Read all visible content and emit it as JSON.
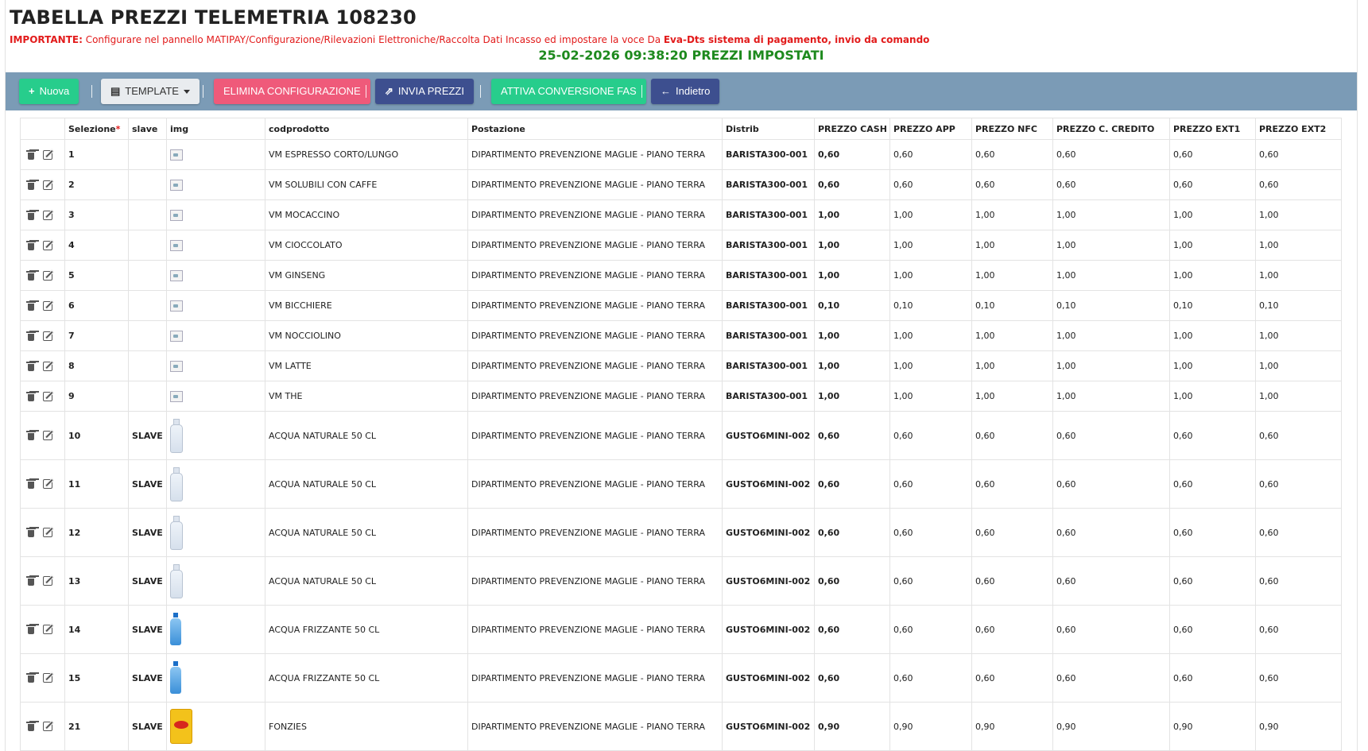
{
  "page": {
    "title": "TABELLA PREZZI TELEMETRIA 108230",
    "notice_label": "IMPORTANTE:",
    "notice_text": " Configurare nel pannello MATIPAY/Configurazione/Rilevazioni Elettroniche/Raccolta Dati Incasso ed impostare la voce Da ",
    "notice_bold": "Eva-Dts sistema di pagamento, invio da comando",
    "status_line": "25-02-2026 09:38:20 PREZZI IMPOSTATI"
  },
  "toolbar": {
    "new_label": "Nuova",
    "template_label": "TEMPLATE",
    "delete_config_label": "ELIMINA CONFIGURAZIONE",
    "send_prices_label": "INVIA PREZZI",
    "enable_conversion_label": "ATTIVA CONVERSIONE FAS",
    "back_label": "Indietro"
  },
  "colors": {
    "toolbar_bg": "#7b9bb6",
    "green_button": "#27cd8c",
    "red_button": "#ef5a7a",
    "navy_button": "#3d4f8f",
    "status_green": "#1e8a1e",
    "notice_red": "#e21b1b"
  },
  "table": {
    "headers": {
      "selezione": "Selezione",
      "required_mark": "*",
      "slave": "slave",
      "img": "img",
      "codprodotto": "codprodotto",
      "postazione": "Postazione",
      "distrib": "Distrib",
      "prezzo_cash": "PREZZO CASH",
      "prezzo_app": "PREZZO APP",
      "prezzo_nfc": "PREZZO NFC",
      "prezzo_cc": "PREZZO C. CREDITO",
      "prezzo_ext1": "PREZZO EXT1",
      "prezzo_ext2": "PREZZO EXT2"
    },
    "rows": [
      {
        "sel": "1",
        "slave": "",
        "img": "broken-img-icon",
        "cod": "VM ESPRESSO CORTO/LUNGO",
        "post": "DIPARTIMENTO PREVENZIONE MAGLIE - PIANO TERRA",
        "distrib": "BARISTA300-001",
        "cash": "0,60",
        "app": "0,60",
        "nfc": "0,60",
        "cc": "0,60",
        "ext1": "0,60",
        "ext2": "0,60"
      },
      {
        "sel": "2",
        "slave": "",
        "img": "broken-img-icon",
        "cod": "VM SOLUBILI CON CAFFE",
        "post": "DIPARTIMENTO PREVENZIONE MAGLIE - PIANO TERRA",
        "distrib": "BARISTA300-001",
        "cash": "0,60",
        "app": "0,60",
        "nfc": "0,60",
        "cc": "0,60",
        "ext1": "0,60",
        "ext2": "0,60"
      },
      {
        "sel": "3",
        "slave": "",
        "img": "broken-img-icon",
        "cod": "VM MOCACCINO",
        "post": "DIPARTIMENTO PREVENZIONE MAGLIE - PIANO TERRA",
        "distrib": "BARISTA300-001",
        "cash": "1,00",
        "app": "1,00",
        "nfc": "1,00",
        "cc": "1,00",
        "ext1": "1,00",
        "ext2": "1,00"
      },
      {
        "sel": "4",
        "slave": "",
        "img": "broken-img-icon",
        "cod": "VM CIOCCOLATO",
        "post": "DIPARTIMENTO PREVENZIONE MAGLIE - PIANO TERRA",
        "distrib": "BARISTA300-001",
        "cash": "1,00",
        "app": "1,00",
        "nfc": "1,00",
        "cc": "1,00",
        "ext1": "1,00",
        "ext2": "1,00"
      },
      {
        "sel": "5",
        "slave": "",
        "img": "broken-img-icon",
        "cod": "VM GINSENG",
        "post": "DIPARTIMENTO PREVENZIONE MAGLIE - PIANO TERRA",
        "distrib": "BARISTA300-001",
        "cash": "1,00",
        "app": "1,00",
        "nfc": "1,00",
        "cc": "1,00",
        "ext1": "1,00",
        "ext2": "1,00"
      },
      {
        "sel": "6",
        "slave": "",
        "img": "broken-img-icon",
        "cod": "VM BICCHIERE",
        "post": "DIPARTIMENTO PREVENZIONE MAGLIE - PIANO TERRA",
        "distrib": "BARISTA300-001",
        "cash": "0,10",
        "app": "0,10",
        "nfc": "0,10",
        "cc": "0,10",
        "ext1": "0,10",
        "ext2": "0,10"
      },
      {
        "sel": "7",
        "slave": "",
        "img": "broken-img-icon",
        "cod": "VM NOCCIOLINO",
        "post": "DIPARTIMENTO PREVENZIONE MAGLIE - PIANO TERRA",
        "distrib": "BARISTA300-001",
        "cash": "1,00",
        "app": "1,00",
        "nfc": "1,00",
        "cc": "1,00",
        "ext1": "1,00",
        "ext2": "1,00"
      },
      {
        "sel": "8",
        "slave": "",
        "img": "broken-img-icon",
        "cod": "VM LATTE",
        "post": "DIPARTIMENTO PREVENZIONE MAGLIE - PIANO TERRA",
        "distrib": "BARISTA300-001",
        "cash": "1,00",
        "app": "1,00",
        "nfc": "1,00",
        "cc": "1,00",
        "ext1": "1,00",
        "ext2": "1,00"
      },
      {
        "sel": "9",
        "slave": "",
        "img": "broken-img-icon",
        "cod": "VM THE",
        "post": "DIPARTIMENTO PREVENZIONE MAGLIE - PIANO TERRA",
        "distrib": "BARISTA300-001",
        "cash": "1,00",
        "app": "1,00",
        "nfc": "1,00",
        "cc": "1,00",
        "ext1": "1,00",
        "ext2": "1,00"
      },
      {
        "sel": "10",
        "slave": "SLAVE",
        "img": "bottle-still-icon",
        "cod": "ACQUA NATURALE 50 CL",
        "post": "DIPARTIMENTO PREVENZIONE MAGLIE - PIANO TERRA",
        "distrib": "GUSTO6MINI-002",
        "cash": "0,60",
        "app": "0,60",
        "nfc": "0,60",
        "cc": "0,60",
        "ext1": "0,60",
        "ext2": "0,60"
      },
      {
        "sel": "11",
        "slave": "SLAVE",
        "img": "bottle-still-icon",
        "cod": "ACQUA NATURALE 50 CL",
        "post": "DIPARTIMENTO PREVENZIONE MAGLIE - PIANO TERRA",
        "distrib": "GUSTO6MINI-002",
        "cash": "0,60",
        "app": "0,60",
        "nfc": "0,60",
        "cc": "0,60",
        "ext1": "0,60",
        "ext2": "0,60"
      },
      {
        "sel": "12",
        "slave": "SLAVE",
        "img": "bottle-still-icon",
        "cod": "ACQUA NATURALE 50 CL",
        "post": "DIPARTIMENTO PREVENZIONE MAGLIE - PIANO TERRA",
        "distrib": "GUSTO6MINI-002",
        "cash": "0,60",
        "app": "0,60",
        "nfc": "0,60",
        "cc": "0,60",
        "ext1": "0,60",
        "ext2": "0,60"
      },
      {
        "sel": "13",
        "slave": "SLAVE",
        "img": "bottle-still-icon",
        "cod": "ACQUA NATURALE 50 CL",
        "post": "DIPARTIMENTO PREVENZIONE MAGLIE - PIANO TERRA",
        "distrib": "GUSTO6MINI-002",
        "cash": "0,60",
        "app": "0,60",
        "nfc": "0,60",
        "cc": "0,60",
        "ext1": "0,60",
        "ext2": "0,60"
      },
      {
        "sel": "14",
        "slave": "SLAVE",
        "img": "bottle-fizzy-icon",
        "cod": "ACQUA FRIZZANTE 50 CL",
        "post": "DIPARTIMENTO PREVENZIONE MAGLIE - PIANO TERRA",
        "distrib": "GUSTO6MINI-002",
        "cash": "0,60",
        "app": "0,60",
        "nfc": "0,60",
        "cc": "0,60",
        "ext1": "0,60",
        "ext2": "0,60"
      },
      {
        "sel": "15",
        "slave": "SLAVE",
        "img": "bottle-fizzy-icon",
        "cod": "ACQUA FRIZZANTE 50 CL",
        "post": "DIPARTIMENTO PREVENZIONE MAGLIE - PIANO TERRA",
        "distrib": "GUSTO6MINI-002",
        "cash": "0,60",
        "app": "0,60",
        "nfc": "0,60",
        "cc": "0,60",
        "ext1": "0,60",
        "ext2": "0,60"
      },
      {
        "sel": "21",
        "slave": "SLAVE",
        "img": "chips-icon",
        "cod": "FONZIES",
        "post": "DIPARTIMENTO PREVENZIONE MAGLIE - PIANO TERRA",
        "distrib": "GUSTO6MINI-002",
        "cash": "0,90",
        "app": "0,90",
        "nfc": "0,90",
        "cc": "0,90",
        "ext1": "0,90",
        "ext2": "0,90"
      }
    ]
  }
}
